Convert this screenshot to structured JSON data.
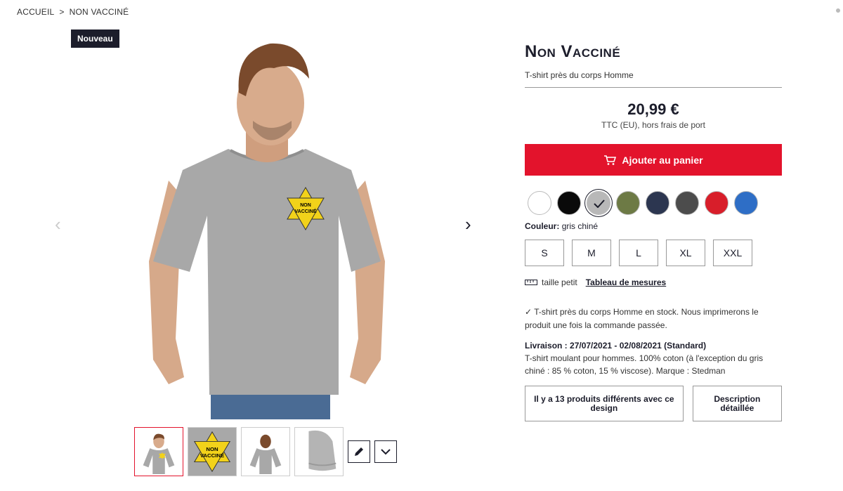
{
  "breadcrumb": {
    "home": "ACCUEIL",
    "separator": ">",
    "current": "NON VACCINÉ"
  },
  "badge": "Nouveau",
  "product": {
    "title": "Non Vacciné",
    "subtitle": "T-shirt près du corps Homme",
    "price": "20,99 €",
    "price_note": "TTC (EU), hors frais de port",
    "add_to_cart": "Ajouter au panier",
    "print_text_line1": "NON",
    "print_text_line2": "VACCINÉ"
  },
  "colors": {
    "swatches": [
      "#ffffff",
      "#0a0a0a",
      "#b8b8b8",
      "#6d7a45",
      "#2c3650",
      "#4c4c4c",
      "#d81e2a",
      "#2e6ec6"
    ],
    "selected_index": 2,
    "label": "Couleur:",
    "value": "gris chiné"
  },
  "sizes": [
    "S",
    "M",
    "L",
    "XL",
    "XXL"
  ],
  "fit": {
    "text": "taille petit",
    "link": "Tableau de mesures"
  },
  "stock_text": "T-shirt près du corps Homme en stock. Nous imprimerons le produit une fois la commande passée.",
  "delivery": {
    "label": "Livraison : 27/07/2021 - 02/08/2021 (Standard)",
    "description": "T-shirt moulant pour hommes. 100% coton (à l'exception du gris chiné : 85 % coton, 15 % viscose). Marque : Stedman"
  },
  "buttons": {
    "designs": "Il y a 13 produits différents avec ce design",
    "description": "Description détaillée"
  },
  "accent": "#e3132c",
  "dark": "#1c1d2b"
}
